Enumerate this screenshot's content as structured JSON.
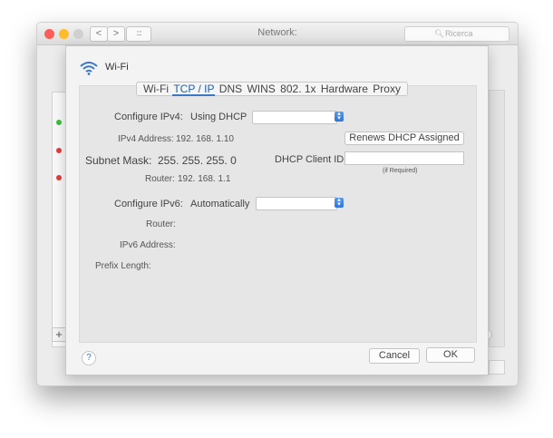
{
  "window": {
    "title": "Network:",
    "search_placeholder": "Ricerca",
    "nav_back": "<",
    "nav_forward": ">",
    "grid": "::::"
  },
  "sidebar": {
    "status_dots": [
      "green",
      "red",
      "red"
    ],
    "add_label": "+"
  },
  "sheet": {
    "service_label": "Wi-Fi",
    "tabs": [
      "Wi-Fi",
      "TCP / IP",
      "DNS",
      "WINS",
      "802. 1x",
      "Hardware",
      "Proxy"
    ],
    "active_tab": "TCP / IP",
    "ipv4": {
      "configure_label": "Configure IPv4:",
      "configure_value": "Using DHCP",
      "address_label": "IPv4 Address:",
      "address_value": "192. 168. 1.10",
      "subnet_label": "Subnet Mask:",
      "subnet_value": "255. 255. 255. 0",
      "router_label": "Router:",
      "router_value": "192. 168. 1.1",
      "renew_button": "Renews DHCP Assigned",
      "dhcp_client_label": "DHCP Client ID:",
      "dhcp_client_value": "",
      "if_required": "(if Required)"
    },
    "ipv6": {
      "configure_label": "Configure IPv6:",
      "configure_value": "Automatically",
      "router_label": "Router:",
      "address_label": "IPv6 Address:",
      "prefix_label": "Prefix Length:"
    },
    "help_label": "?",
    "cancel_button": "Cancel",
    "ok_button": "OK"
  },
  "colors": {
    "accent": "#3a77c6",
    "status_green": "#3cc13b",
    "status_red": "#e0403a",
    "light_close": "#fb5f57",
    "light_min": "#fdbc2e",
    "light_disabled": "#d0d0d0"
  }
}
